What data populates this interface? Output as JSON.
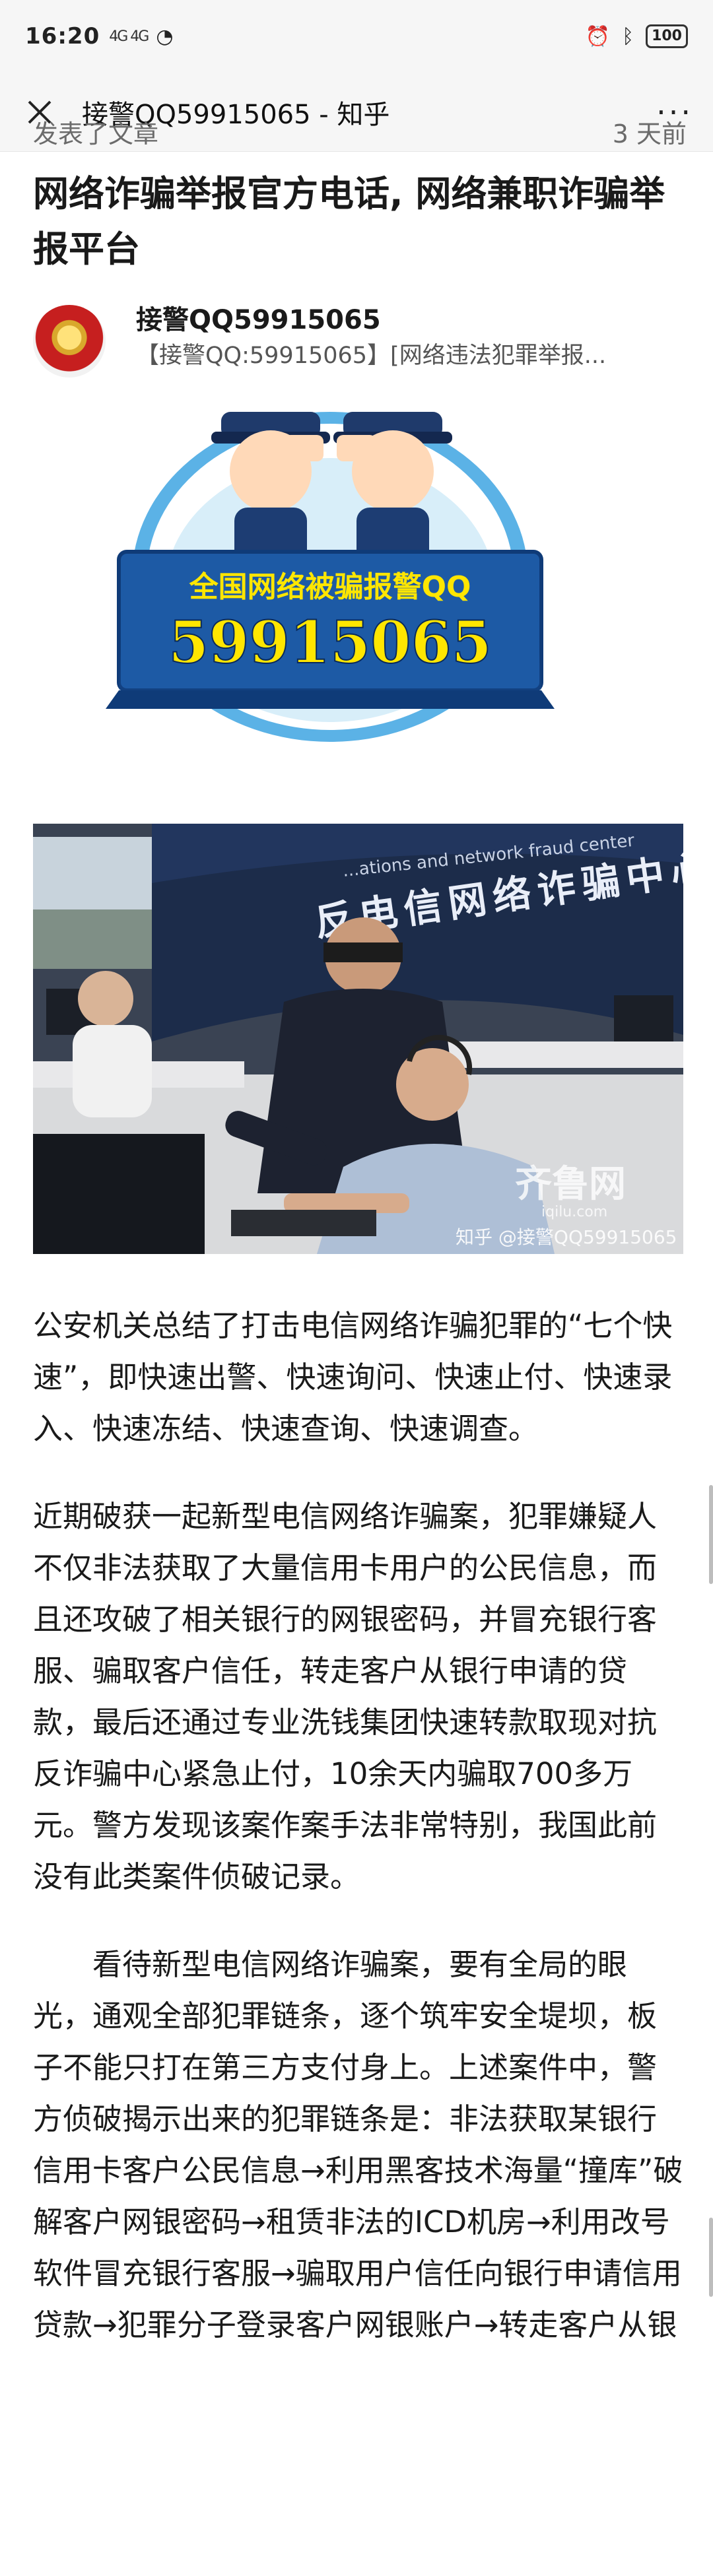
{
  "status_bar": {
    "time": "16:20",
    "signal_text": "4G 4G",
    "battery": "100"
  },
  "nav": {
    "title": "接警QQ59915065 - 知乎",
    "more": "···"
  },
  "article_header": {
    "partial_left": "发表了文章",
    "partial_right": "3 天前",
    "title": "网络诈骗举报官方电话, 网络兼职诈骗举报平台"
  },
  "author": {
    "name": "接警QQ59915065",
    "bio": "【接警QQ:59915065】[网络违法犯罪举报..."
  },
  "banner": {
    "line1": "全国网络被骗报警QQ",
    "line2": "59915065"
  },
  "photo": {
    "sign_cn": "反电信网络诈骗中心",
    "sign_en": "...ations and network fraud center",
    "watermark_site": "齐鲁网",
    "watermark_domain": "iqilu.com",
    "watermark_zhihu": "知乎 @接警QQ59915065"
  },
  "paragraphs": [
    "公安机关总结了打击电信网络诈骗犯罪的“七个快速”，即快速出警、快速询问、快速止付、快速录入、快速冻结、快速查询、快速调查。",
    "近期破获一起新型电信网络诈骗案，犯罪嫌疑人不仅非法获取了大量信用卡用户的公民信息，而且还攻破了相关银行的网银密码，并冒充银行客服、骗取客户信任，转走客户从银行申请的贷款，最后还通过专业洗钱集团快速转款取现对抗反诈骗中心紧急止付，10余天内骗取700多万元。警方发现该案作案手法非常特别，我国此前没有此类案件侦破记录。",
    "看待新型电信网络诈骗案，要有全局的眼光，通观全部犯罪链条，逐个筑牢安全堤坝，板子不能只打在第三方支付身上。上述案件中，警方侦破揭示出来的犯罪链条是：非法获取某银行信用卡客户公民信息→利用黑客技术海量“撞库”破解客户网银密码→租赁非法的ICD机房→利用改号软件冒充银行客服→骗取用户信任向银行申请信用贷款→犯罪分子登录客户网银账户→转走客户从银"
  ],
  "colors": {
    "banner_blue": "#1d5aa5",
    "banner_yellow": "#ffe600",
    "text": "#1a1a1a"
  }
}
